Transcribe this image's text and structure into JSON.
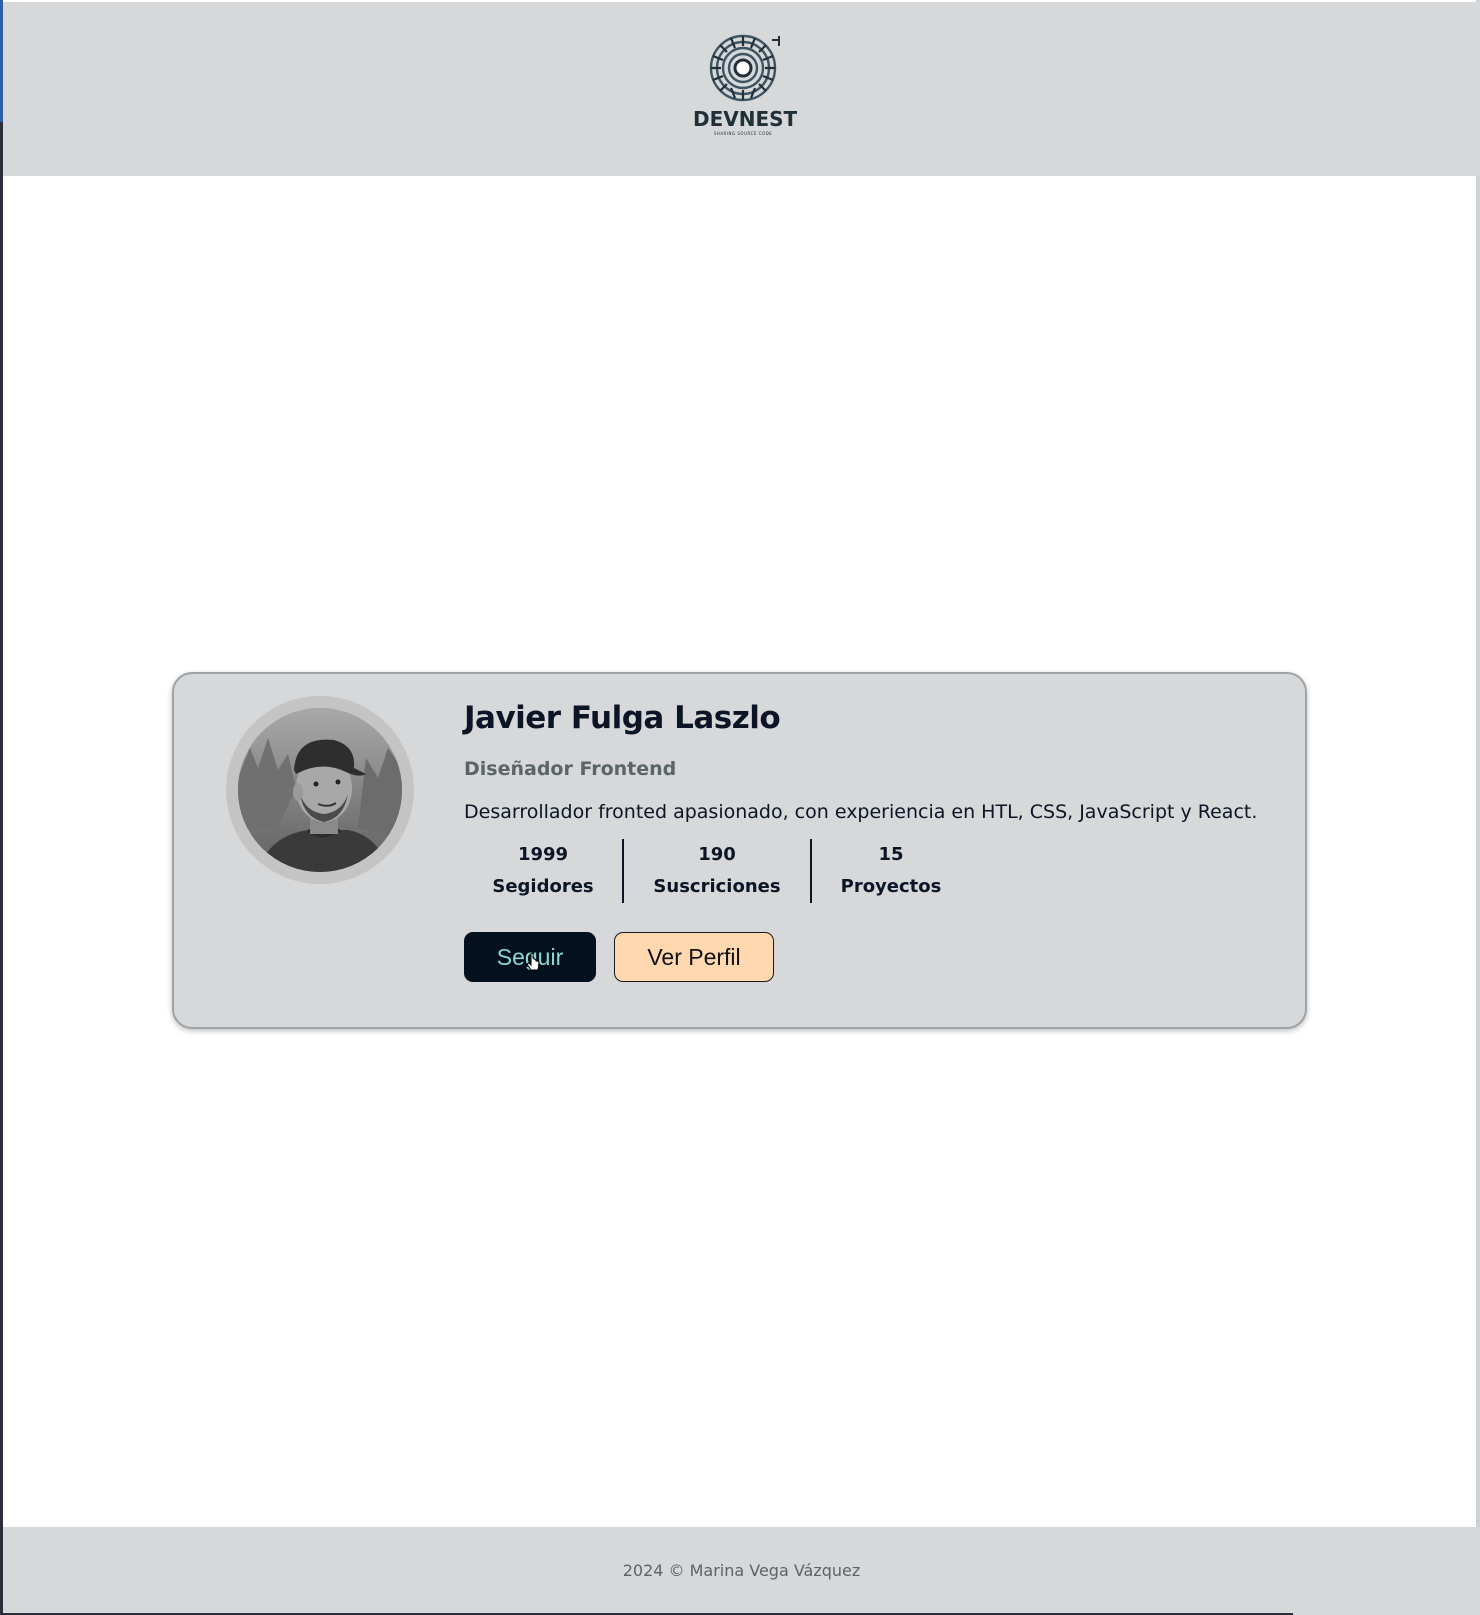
{
  "header": {
    "logo_text": "DEVNEST",
    "logo_tagline": "SHARING SOURCE CODE"
  },
  "profile": {
    "name": "Javier Fulga Laszlo",
    "role": "Diseñador Frontend",
    "bio": "Desarrollador fronted apasionado, con experiencia en HTL, CSS, JavaScript y React.",
    "stats": [
      {
        "value": "1999",
        "label": "Segidores"
      },
      {
        "value": "190",
        "label": "Suscriciones"
      },
      {
        "value": "15",
        "label": "Proyectos"
      }
    ],
    "follow_label": "Seguir",
    "view_profile_label": "Ver Perfil"
  },
  "footer": {
    "text": "2024 © Marina Vega Vázquez"
  },
  "colors": {
    "header_bg": "#d6d8d9",
    "card_bg": "#d6d8d9",
    "text_dark": "#0b1526",
    "follow_bg": "#03111f",
    "follow_text": "#8fd8d0",
    "profile_btn_bg": "#ffd8b0"
  },
  "icons": {
    "logo": "devnest-logo-icon",
    "avatar": "avatar",
    "cursor": "mouse-pointer-icon"
  }
}
